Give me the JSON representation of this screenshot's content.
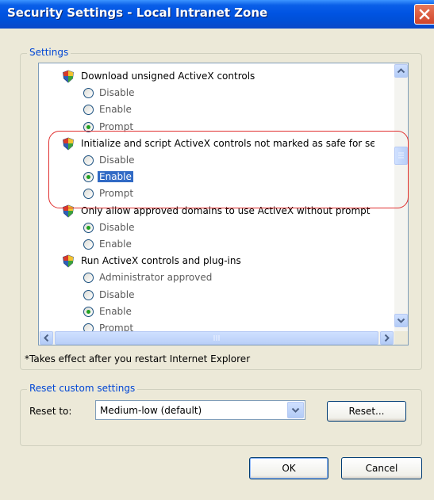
{
  "window": {
    "title": "Security Settings - Local Intranet Zone"
  },
  "settings_group": {
    "legend": "Settings",
    "items": [
      {
        "type": "header",
        "label": "Download unsigned ActiveX controls"
      },
      {
        "type": "option",
        "label": "Disable",
        "checked": false
      },
      {
        "type": "option",
        "label": "Enable",
        "checked": false
      },
      {
        "type": "option",
        "label": "Prompt",
        "checked": true
      },
      {
        "type": "header",
        "label": "Initialize and script ActiveX controls not marked as safe for sє"
      },
      {
        "type": "option",
        "label": "Disable",
        "checked": false
      },
      {
        "type": "option",
        "label": "Enable",
        "checked": true,
        "selected": true
      },
      {
        "type": "option",
        "label": "Prompt",
        "checked": false
      },
      {
        "type": "header",
        "label": "Only allow approved domains to use ActiveX without prompt"
      },
      {
        "type": "option",
        "label": "Disable",
        "checked": true
      },
      {
        "type": "option",
        "label": "Enable",
        "checked": false
      },
      {
        "type": "header",
        "label": "Run ActiveX controls and plug-ins"
      },
      {
        "type": "option",
        "label": "Administrator approved",
        "checked": false
      },
      {
        "type": "option",
        "label": "Disable",
        "checked": false
      },
      {
        "type": "option",
        "label": "Enable",
        "checked": true
      },
      {
        "type": "option",
        "label": "Prompt",
        "checked": false
      }
    ],
    "note": "*Takes effect after you restart Internet Explorer"
  },
  "reset_group": {
    "legend": "Reset custom settings",
    "reset_to_label": "Reset to:",
    "selected_level": "Medium-low (default)",
    "reset_button": "Reset..."
  },
  "footer": {
    "ok": "OK",
    "cancel": "Cancel"
  },
  "colors": {
    "titlebar": "#0054e3",
    "legend_text": "#0046d5",
    "selection": "#316ac5",
    "annotation": "#e03030"
  }
}
